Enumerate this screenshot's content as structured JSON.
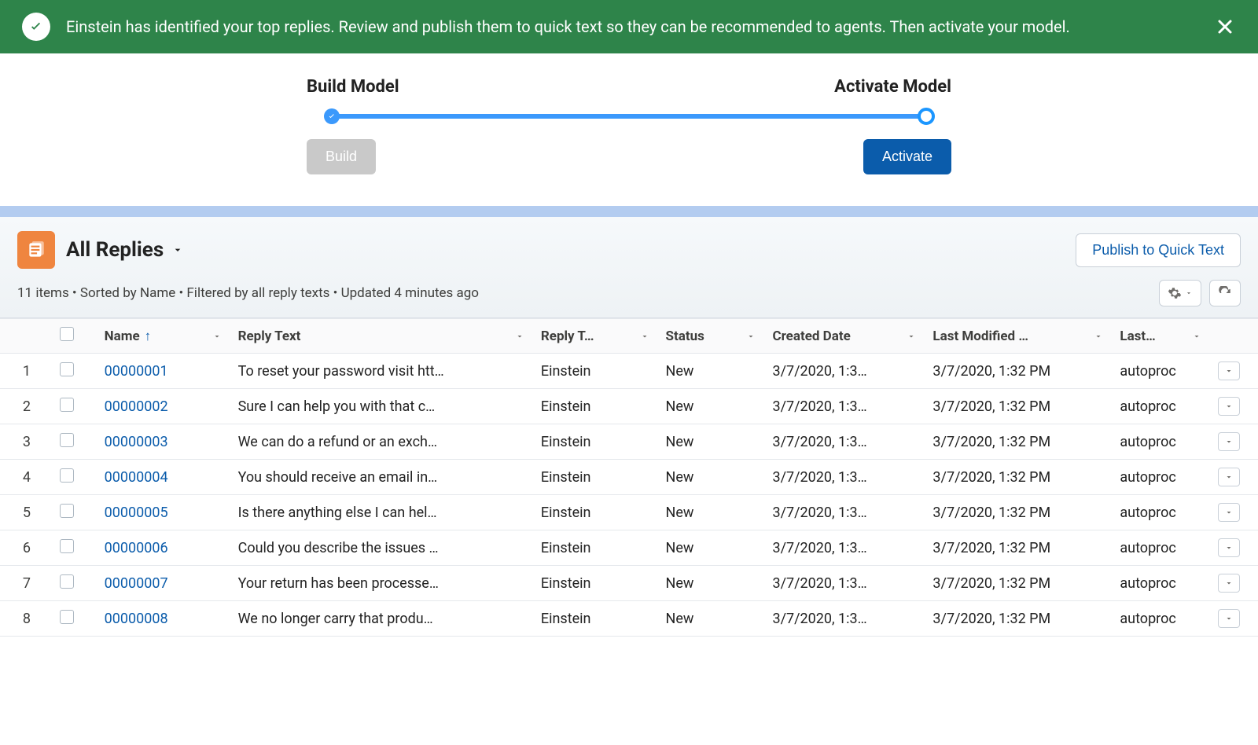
{
  "banner": {
    "text": "Einstein has identified your top replies. Review and publish them to quick text so they can be recommended to agents. Then activate your model."
  },
  "progress": {
    "step1": "Build Model",
    "step2": "Activate Model",
    "build_label": "Build",
    "activate_label": "Activate"
  },
  "list": {
    "title": "All Replies",
    "meta": "11 items • Sorted by Name • Filtered by all reply texts • Updated 4 minutes ago",
    "publish_label": "Publish to Quick Text"
  },
  "columns": {
    "name": "Name",
    "reply_text": "Reply Text",
    "reply_type": "Reply T…",
    "status": "Status",
    "created": "Created Date",
    "modified": "Last Modified …",
    "last": "Last…"
  },
  "rows": [
    {
      "num": "1",
      "name": "00000001",
      "reply": "To reset your password visit htt…",
      "type": "Einstein",
      "status": "New",
      "created": "3/7/2020, 1:3…",
      "modified": "3/7/2020, 1:32 PM",
      "last": "autoproc"
    },
    {
      "num": "2",
      "name": "00000002",
      "reply": "Sure I can help you with that c…",
      "type": "Einstein",
      "status": "New",
      "created": "3/7/2020, 1:3…",
      "modified": "3/7/2020, 1:32 PM",
      "last": "autoproc"
    },
    {
      "num": "3",
      "name": "00000003",
      "reply": "We can do a refund or an exch…",
      "type": "Einstein",
      "status": "New",
      "created": "3/7/2020, 1:3…",
      "modified": "3/7/2020, 1:32 PM",
      "last": "autoproc"
    },
    {
      "num": "4",
      "name": "00000004",
      "reply": "You should receive an email in…",
      "type": "Einstein",
      "status": "New",
      "created": "3/7/2020, 1:3…",
      "modified": "3/7/2020, 1:32 PM",
      "last": "autoproc"
    },
    {
      "num": "5",
      "name": "00000005",
      "reply": "Is there anything else I can hel…",
      "type": "Einstein",
      "status": "New",
      "created": "3/7/2020, 1:3…",
      "modified": "3/7/2020, 1:32 PM",
      "last": "autoproc"
    },
    {
      "num": "6",
      "name": "00000006",
      "reply": "Could you describe the issues …",
      "type": "Einstein",
      "status": "New",
      "created": "3/7/2020, 1:3…",
      "modified": "3/7/2020, 1:32 PM",
      "last": "autoproc"
    },
    {
      "num": "7",
      "name": "00000007",
      "reply": "Your return has been processe…",
      "type": "Einstein",
      "status": "New",
      "created": "3/7/2020, 1:3…",
      "modified": "3/7/2020, 1:32 PM",
      "last": "autoproc"
    },
    {
      "num": "8",
      "name": "00000008",
      "reply": "We no longer carry that produ…",
      "type": "Einstein",
      "status": "New",
      "created": "3/7/2020, 1:3…",
      "modified": "3/7/2020, 1:32 PM",
      "last": "autoproc"
    }
  ]
}
